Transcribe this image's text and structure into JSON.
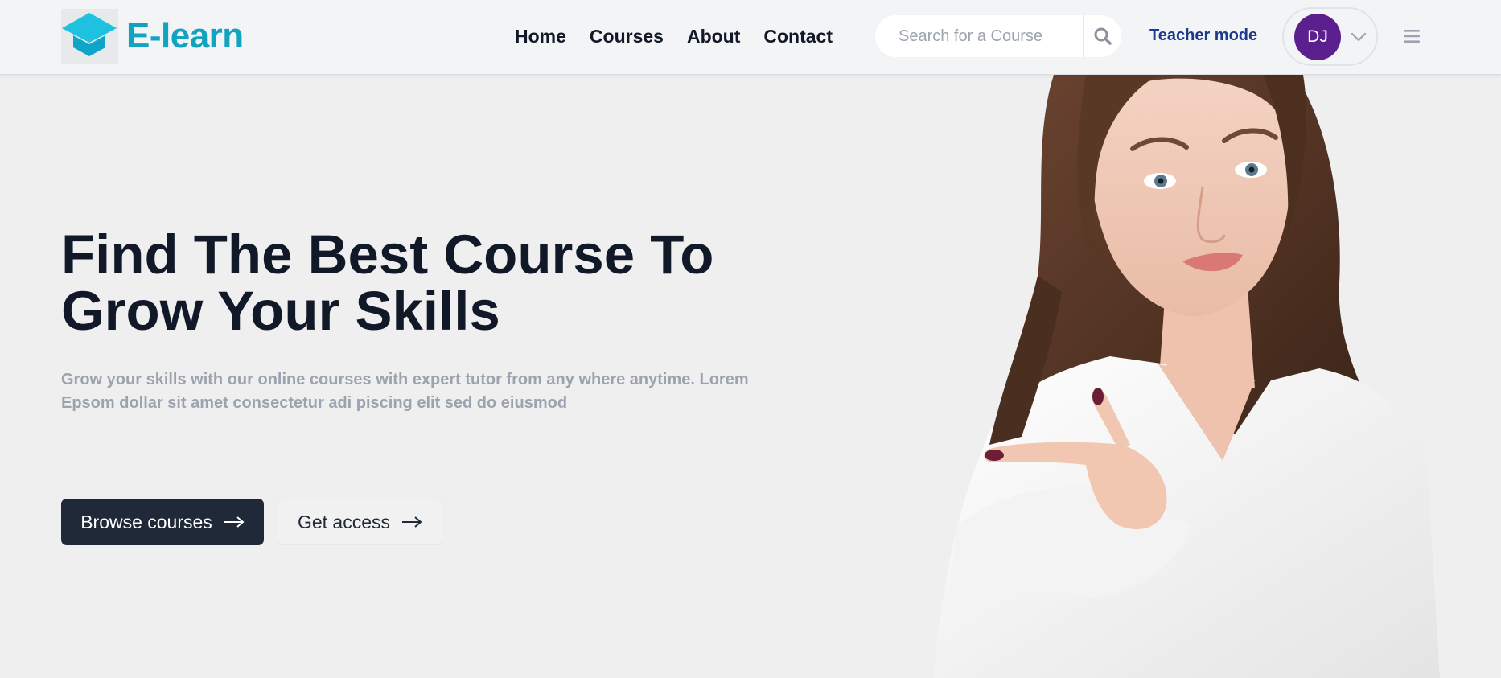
{
  "brand": {
    "name": "E-learn",
    "logo_icon": "graduation-cap-icon",
    "color": "#12a3c1"
  },
  "nav": {
    "items": [
      {
        "label": "Home"
      },
      {
        "label": "Courses"
      },
      {
        "label": "About"
      },
      {
        "label": "Contact"
      }
    ]
  },
  "search": {
    "placeholder": "Search for a Course",
    "value": "",
    "icon": "search-icon"
  },
  "header": {
    "teacher_mode_label": "Teacher mode",
    "avatar_initials": "DJ",
    "avatar_color": "#5b1f8e",
    "dropdown_icon": "chevron-down-icon",
    "menu_icon": "hamburger-menu-icon"
  },
  "hero": {
    "title_line1": "Find The Best Course To",
    "title_line2": "Grow Your Skills",
    "subtitle_line1": "Grow your skills with our online courses with expert tutor from any where anytime. Lorem",
    "subtitle_line2": "Epsom dollar sit amet consectetur adi piscing elit sed do eiusmod",
    "primary_button": "Browse courses",
    "secondary_button": "Get access",
    "arrow_icon": "arrow-right-icon"
  },
  "colors": {
    "header_bg": "#f3f4f6",
    "page_bg": "#efefef",
    "primary_button_bg": "#1f2937",
    "teacher_mode": "#1e3a8a"
  }
}
